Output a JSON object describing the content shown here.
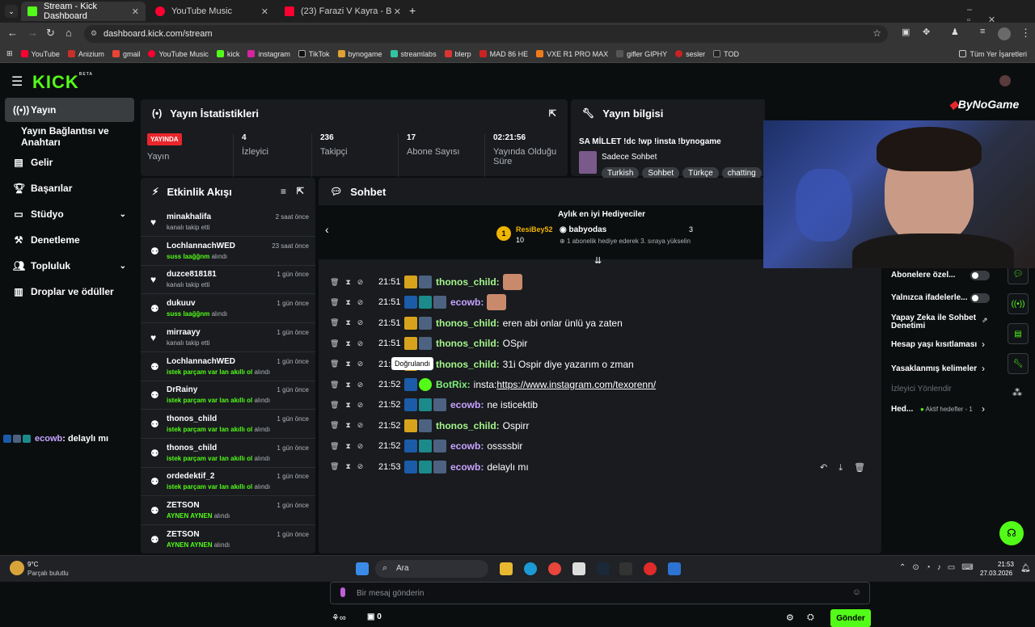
{
  "browser": {
    "tabs": [
      {
        "title": "Stream - Kick Dashboard",
        "color": "#53fc18"
      },
      {
        "title": "YouTube Music",
        "color": "#ff0033"
      },
      {
        "title": "(23) Farazi V Kayra - Bir Gü",
        "color": "#ff0033"
      }
    ],
    "url": "dashboard.kick.com/stream",
    "bookmarks": [
      "YouTube",
      "Anizium",
      "gmail",
      "YouTube Music",
      "kick",
      "instagram",
      "TikTok",
      "bynogame",
      "streamlabs",
      "blerp",
      "MAD 86 HE",
      "VXE R1 PRO MAX",
      "gifler GIPHY",
      "sesler",
      "TOD"
    ],
    "bookmarks_all": "Tüm Yer İşaretleri"
  },
  "app": {
    "logo": "KICK",
    "logo_sup": "BETA",
    "brand_overlay": "ByNoGame"
  },
  "sidebar": {
    "items": [
      {
        "label": "Yayın",
        "icon": "broadcast-icon"
      },
      {
        "label": "Yayın Bağlantısı ve Anahtarı",
        "icon": ""
      },
      {
        "label": "Gelir",
        "icon": "revenue-icon"
      },
      {
        "label": "Başarılar",
        "icon": "trophy-icon"
      },
      {
        "label": "Stüdyo",
        "icon": "studio-icon"
      },
      {
        "label": "Denetleme",
        "icon": "moderation-icon"
      },
      {
        "label": "Topluluk",
        "icon": "community-icon"
      },
      {
        "label": "Droplar ve ödüller",
        "icon": "drops-icon"
      }
    ]
  },
  "stats": {
    "title": "Yayın İstatistikleri",
    "live_badge": "YAYINDA",
    "live_label": "Yayın",
    "items": [
      {
        "value": "4",
        "label": "İzleyici"
      },
      {
        "value": "236",
        "label": "Takipçi"
      },
      {
        "value": "17",
        "label": "Abone Sayısı"
      },
      {
        "value": "02:21:56",
        "label": "Yayında Olduğu Süre"
      }
    ]
  },
  "stream_info": {
    "title": "Yayın bilgisi",
    "stream_title": "SA MİLLET !dc !wp !insta !bynogame",
    "category": "Sadece Sohbet",
    "tags": [
      "Turkish",
      "Sohbet",
      "Türkçe",
      "chatting"
    ]
  },
  "activity": {
    "title": "Etkinlik Akışı",
    "items": [
      {
        "name": "minakhalifa",
        "sub": "kanalı takip etti",
        "highlight": "",
        "suffix": "",
        "time": "2 saat önce",
        "icon": "heart-icon"
      },
      {
        "name": "LochlannachWED",
        "sub": "",
        "highlight": "suss laağğnm",
        "suffix": " alındı",
        "time": "23 saat önce",
        "icon": "redeem-icon"
      },
      {
        "name": "duzce818181",
        "sub": "kanalı takip etti",
        "highlight": "",
        "suffix": "",
        "time": "1 gün önce",
        "icon": "heart-icon"
      },
      {
        "name": "dukuuv",
        "sub": "",
        "highlight": "suss laağğnm",
        "suffix": " alındı",
        "time": "1 gün önce",
        "icon": "redeem-icon"
      },
      {
        "name": "mirraayy",
        "sub": "kanalı takip etti",
        "highlight": "",
        "suffix": "",
        "time": "1 gün önce",
        "icon": "heart-icon"
      },
      {
        "name": "LochlannachWED",
        "sub": "",
        "highlight": "istek parçam var lan akıllı ol",
        "suffix": " alındı",
        "time": "1 gün önce",
        "icon": "redeem-icon"
      },
      {
        "name": "DrRainy",
        "sub": "",
        "highlight": "istek parçam var lan akıllı ol",
        "suffix": " alındı",
        "time": "1 gün önce",
        "icon": "redeem-icon"
      },
      {
        "name": "thonos_child",
        "sub": "",
        "highlight": "istek parçam var lan akıllı ol",
        "suffix": " alındı",
        "time": "1 gün önce",
        "icon": "redeem-icon"
      },
      {
        "name": "thonos_child",
        "sub": "",
        "highlight": "istek parçam var lan akıllı ol",
        "suffix": " alındı",
        "time": "1 gün önce",
        "icon": "redeem-icon"
      },
      {
        "name": "ordedektif_2",
        "sub": "",
        "highlight": "istek parçam var lan akıllı ol",
        "suffix": " alındı",
        "time": "1 gün önce",
        "icon": "redeem-icon"
      },
      {
        "name": "ZETSON",
        "sub": "",
        "highlight": "AYNEN AYNEN",
        "suffix": " alındı",
        "time": "1 gün önce",
        "icon": "redeem-icon"
      },
      {
        "name": "ZETSON",
        "sub": "",
        "highlight": "AYNEN AYNEN",
        "suffix": " alındı",
        "time": "1 gün önce",
        "icon": "redeem-icon"
      }
    ]
  },
  "overlay_chat": {
    "user": "ecowb",
    "text": ": delaylı mı"
  },
  "chat": {
    "title": "Sohbet",
    "gifters_title": "Aylık en iyi Hediyeciler",
    "gifter1": {
      "rank": "1",
      "name": "ResiBey52",
      "count": "10"
    },
    "gifter2": {
      "name": "babyodas",
      "count": "3",
      "note": "1 abonelik hediye ederek 3. sıraya yükselin"
    },
    "tooltip": "Doğrulandı",
    "messages": [
      {
        "time": "21:51",
        "user": "thonos_child",
        "text": "",
        "cls": "u1",
        "badges": [
          "b-crown",
          "b-av"
        ],
        "emote": true
      },
      {
        "time": "21:51",
        "user": "ecowb",
        "text": "",
        "cls": "u2",
        "badges": [
          "b-hammer",
          "b-gg",
          "b-av"
        ],
        "emote": true
      },
      {
        "time": "21:51",
        "user": "thonos_child",
        "text": "eren abi onlar ünlü ya zaten",
        "cls": "u1",
        "badges": [
          "b-crown",
          "b-av"
        ],
        "emote": false
      },
      {
        "time": "21:51",
        "user": "thonos_child",
        "text": "OSpir",
        "cls": "u1",
        "badges": [
          "b-crown",
          "b-av"
        ],
        "emote": false
      },
      {
        "time": "21:52",
        "user": "thonos_child",
        "text": "31i Ospir diye yazarım o zman",
        "cls": "u1",
        "badges": [
          "b-crown",
          "b-av"
        ],
        "emote": false
      },
      {
        "time": "21:52",
        "user": "BotRix",
        "text": "insta: ",
        "cls": "u3",
        "badges": [
          "b-hammer",
          "b-check"
        ],
        "emote": false,
        "link": "https://www.instagram.com/texorenn/"
      },
      {
        "time": "21:52",
        "user": "ecowb",
        "text": "ne isticektib",
        "cls": "u2",
        "badges": [
          "b-hammer",
          "b-gg",
          "b-av"
        ],
        "emote": false
      },
      {
        "time": "21:52",
        "user": "thonos_child",
        "text": "Ospirr",
        "cls": "u1",
        "badges": [
          "b-crown",
          "b-av"
        ],
        "emote": false
      },
      {
        "time": "21:52",
        "user": "ecowb",
        "text": "ossssbir",
        "cls": "u2",
        "badges": [
          "b-hammer",
          "b-gg",
          "b-av"
        ],
        "emote": false
      },
      {
        "time": "21:53",
        "user": "ecowb",
        "text": "delaylı mı",
        "cls": "u2",
        "badges": [
          "b-hammer",
          "b-gg",
          "b-av"
        ],
        "emote": false
      }
    ],
    "input_placeholder": "Bir mesaj gönderin",
    "points": "0",
    "send_label": "Gönder"
  },
  "settings": {
    "items": [
      {
        "label": "Abonelere özel...",
        "type": "toggle"
      },
      {
        "label": "Yalnızca ifadelerle...",
        "type": "toggle"
      },
      {
        "label": "Yapay Zeka ile Sohbet Denetimi",
        "type": "link"
      },
      {
        "label": "Hesap yaşı kısıtlaması",
        "type": "chevron"
      },
      {
        "label": "Yasaklanmış kelimeler",
        "type": "chevron"
      },
      {
        "label": "İzleyici Yönlendir",
        "type": "muted"
      },
      {
        "label": "Hed...",
        "type": "goals",
        "goals_text": "Aktif hedefler - 1"
      }
    ]
  },
  "taskbar": {
    "temp": "9°C",
    "weather": "Parçalı bulutlu",
    "search": "Ara",
    "time": "21:53",
    "date": "27.03.2026"
  },
  "colors": {
    "accent": "#53fc18",
    "live": "#e8262c",
    "panel": "#191b1f"
  }
}
